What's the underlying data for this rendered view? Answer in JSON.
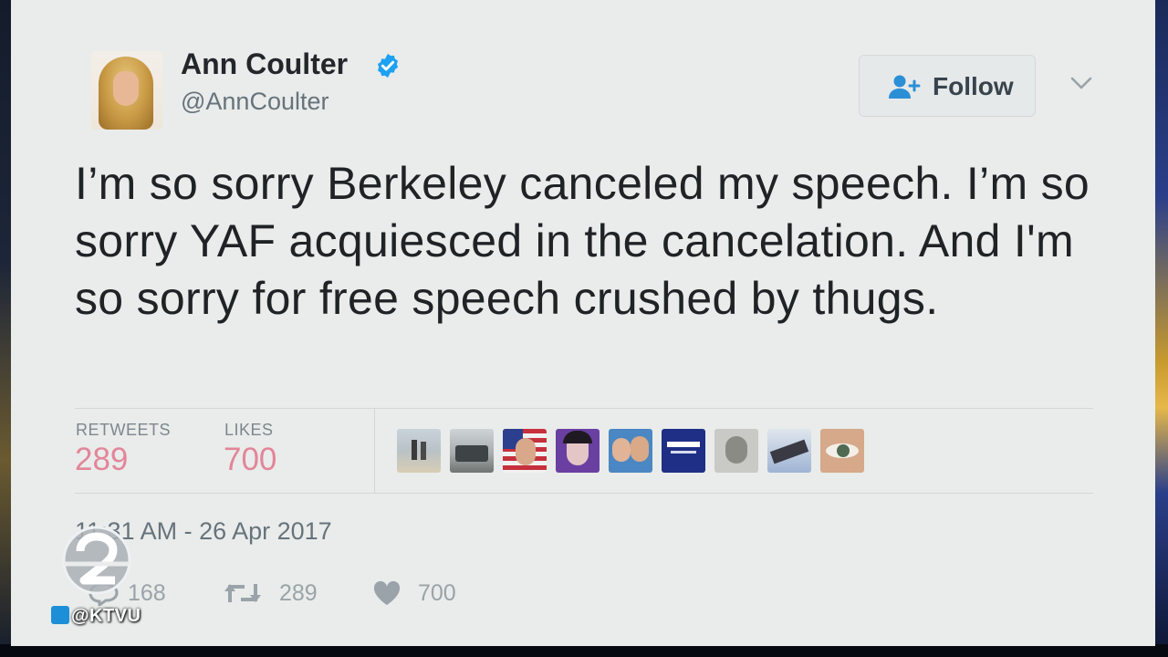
{
  "tweet": {
    "author_name": "Ann Coulter",
    "handle": "@AnnCoulter",
    "follow_label": "Follow",
    "text": "I’m so sorry Berkeley canceled my speech. I’m so sorry YAF acquiesced in the cancelation. And I'm so sorry for free speech crushed by thugs.",
    "stats": {
      "retweets_label": "RETWEETS",
      "retweets_value": "289",
      "likes_label": "LIKES",
      "likes_value": "700"
    },
    "likers": [
      "liker-avatar-beach",
      "liker-avatar-truck",
      "liker-avatar-flag",
      "liker-avatar-woman",
      "liker-avatar-couple",
      "liker-avatar-trump-pence",
      "liker-avatar-child",
      "liker-avatar-eagle",
      "liker-avatar-eye"
    ],
    "timestamp": "11:31 AM - 26 Apr 2017",
    "actions": {
      "reply_count": "168",
      "retweet_count": "289",
      "like_count": "700"
    }
  },
  "broadcast": {
    "channel_handle": "@KTVU"
  },
  "colors": {
    "card_bg": "#e9ecea",
    "stat_value": "#e3859a",
    "verified_blue": "#1da1f2",
    "muted_text": "#67737c"
  }
}
